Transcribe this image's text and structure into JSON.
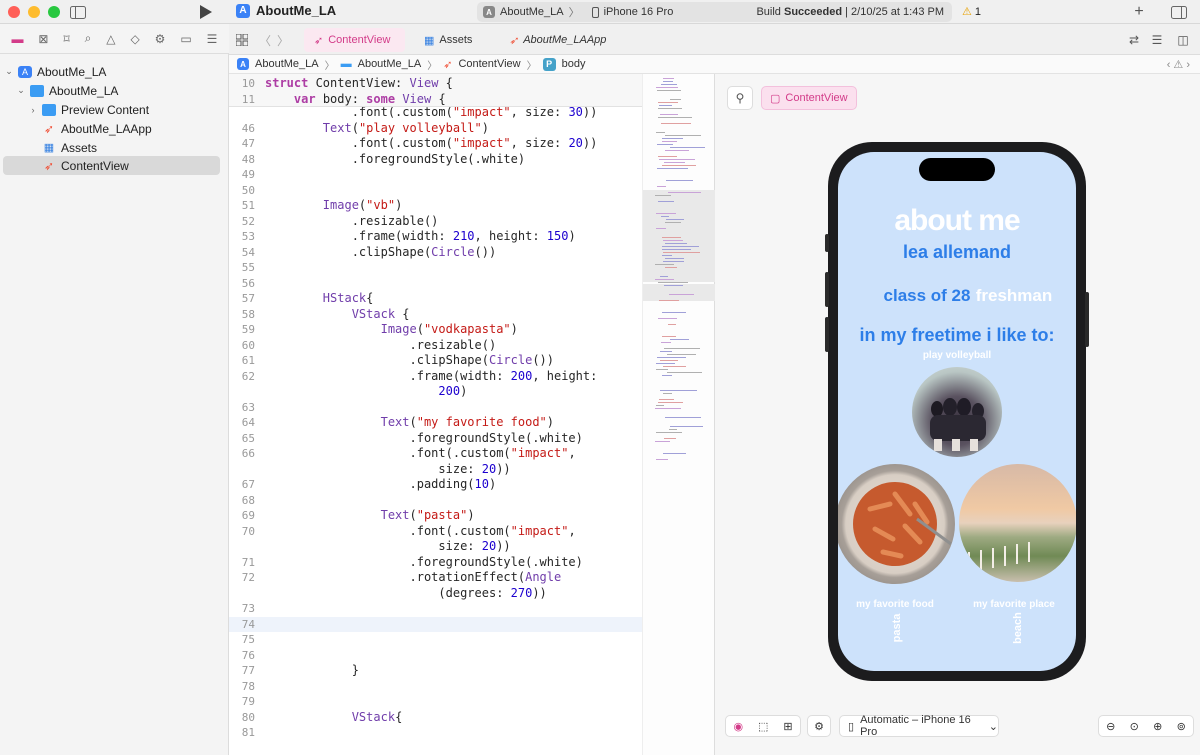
{
  "window": {
    "project_title": "AboutMe_LA",
    "scheme_target": "AboutMe_LA",
    "scheme_device": "iPhone 16 Pro",
    "build_status_prefix": "Build ",
    "build_status_strong": "Succeeded",
    "build_status_suffix": " | 2/10/25 at 1:43 PM",
    "warning_count": "1"
  },
  "navigator": {
    "rows": [
      {
        "label": "AboutMe_LA",
        "icon": "app-icon"
      },
      {
        "label": "AboutMe_LA",
        "icon": "folder-icon"
      },
      {
        "label": "Preview Content",
        "icon": "folder-icon"
      },
      {
        "label": "AboutMe_LAApp",
        "icon": "swift-file-icon"
      },
      {
        "label": "Assets",
        "icon": "asset-catalog-icon"
      },
      {
        "label": "ContentView",
        "icon": "swift-file-icon"
      }
    ]
  },
  "tabs": [
    {
      "label": "ContentView"
    },
    {
      "label": "Assets"
    },
    {
      "label": "AboutMe_LAApp"
    }
  ],
  "breadcrumb": [
    "AboutMe_LA",
    "AboutMe_LA",
    "ContentView",
    "body"
  ],
  "editor": {
    "sticky": [
      {
        "n": "10",
        "text": "struct ContentView: View {"
      },
      {
        "n": "11",
        "text": "    var body: some View {"
      }
    ],
    "lines": [
      {
        "n": "",
        "text": "            .font(.custom(\"impact\", size: 30))"
      },
      {
        "n": "46",
        "text": "        Text(\"play volleyball\")"
      },
      {
        "n": "47",
        "text": "            .font(.custom(\"impact\", size: 20))"
      },
      {
        "n": "48",
        "text": "            .foregroundStyle(.white)"
      },
      {
        "n": "49",
        "text": ""
      },
      {
        "n": "50",
        "text": ""
      },
      {
        "n": "51",
        "text": "        Image(\"vb\")"
      },
      {
        "n": "52",
        "text": "            .resizable()"
      },
      {
        "n": "53",
        "text": "            .frame(width: 210, height: 150)"
      },
      {
        "n": "54",
        "text": "            .clipShape(Circle())"
      },
      {
        "n": "55",
        "text": ""
      },
      {
        "n": "56",
        "text": ""
      },
      {
        "n": "57",
        "text": "        HStack{"
      },
      {
        "n": "58",
        "text": "            VStack {"
      },
      {
        "n": "59",
        "text": "                Image(\"vodkapasta\")"
      },
      {
        "n": "60",
        "text": "                    .resizable()"
      },
      {
        "n": "61",
        "text": "                    .clipShape(Circle())"
      },
      {
        "n": "62",
        "text": "                    .frame(width: 200, height:"
      },
      {
        "n": "",
        "text": "                        200)"
      },
      {
        "n": "63",
        "text": ""
      },
      {
        "n": "64",
        "text": "                Text(\"my favorite food\")"
      },
      {
        "n": "65",
        "text": "                    .foregroundStyle(.white)"
      },
      {
        "n": "66",
        "text": "                    .font(.custom(\"impact\","
      },
      {
        "n": "",
        "text": "                        size: 20))"
      },
      {
        "n": "67",
        "text": "                    .padding(10)"
      },
      {
        "n": "68",
        "text": ""
      },
      {
        "n": "69",
        "text": "                Text(\"pasta\")"
      },
      {
        "n": "70",
        "text": "                    .font(.custom(\"impact\","
      },
      {
        "n": "",
        "text": "                        size: 20))"
      },
      {
        "n": "71",
        "text": "                    .foregroundStyle(.white)"
      },
      {
        "n": "72",
        "text": "                    .rotationEffect(Angle"
      },
      {
        "n": "",
        "text": "                        (degrees: 270))"
      },
      {
        "n": "73",
        "text": ""
      },
      {
        "n": "74",
        "text": ""
      },
      {
        "n": "75",
        "text": ""
      },
      {
        "n": "76",
        "text": ""
      },
      {
        "n": "77",
        "text": "            }"
      },
      {
        "n": "78",
        "text": ""
      },
      {
        "n": "79",
        "text": ""
      },
      {
        "n": "80",
        "text": "            VStack{"
      },
      {
        "n": "81",
        "text": ""
      }
    ],
    "current_line": "74"
  },
  "canvas": {
    "chip_label": "ContentView",
    "device_menu": "Automatic – iPhone 16 Pro"
  },
  "preview": {
    "title": "about me",
    "name": "lea allemand",
    "class_label": "class of 28",
    "grade": "freshman",
    "freetime": "in my freetime i like to:",
    "activity": "play volleyball",
    "food_caption": "my favorite food",
    "food": "pasta",
    "place_caption": "my favorite place",
    "place": "beach",
    "bg_color": "#cde2fb",
    "accent_color": "#2d7ee8"
  }
}
